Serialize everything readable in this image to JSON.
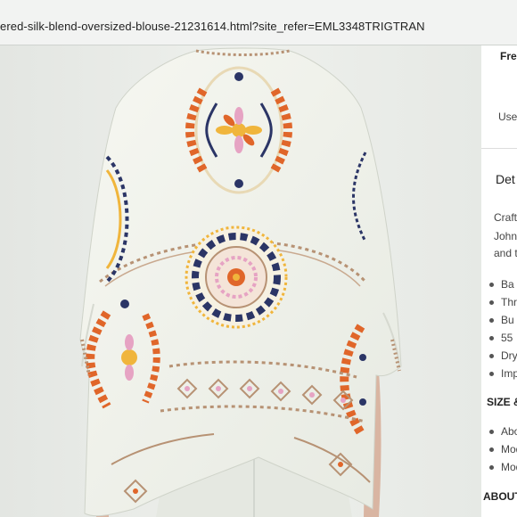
{
  "browser": {
    "url": "ered-silk-blend-oversized-blouse-21231614.html?site_refer=EML3348TRIGTRAN"
  },
  "sidebar": {
    "top_label": "Fre",
    "use_label": "Use",
    "details_title": "Det",
    "description_lines": [
      "Craft",
      "John",
      "and t"
    ],
    "bullets": [
      "Ba",
      "Thr",
      "Bu",
      "55",
      "Dry",
      "Imp"
    ],
    "size_heading": "SIZE &",
    "size_bullets": [
      "Abo",
      "Mod",
      "Mod"
    ],
    "about_heading": "ABOUT"
  },
  "colors": {
    "fabric": "#f1f3ec",
    "orange": "#e0662a",
    "navy": "#2b3566",
    "pink": "#e6a3c3",
    "tan": "#b79274",
    "gold": "#f0b53c"
  }
}
